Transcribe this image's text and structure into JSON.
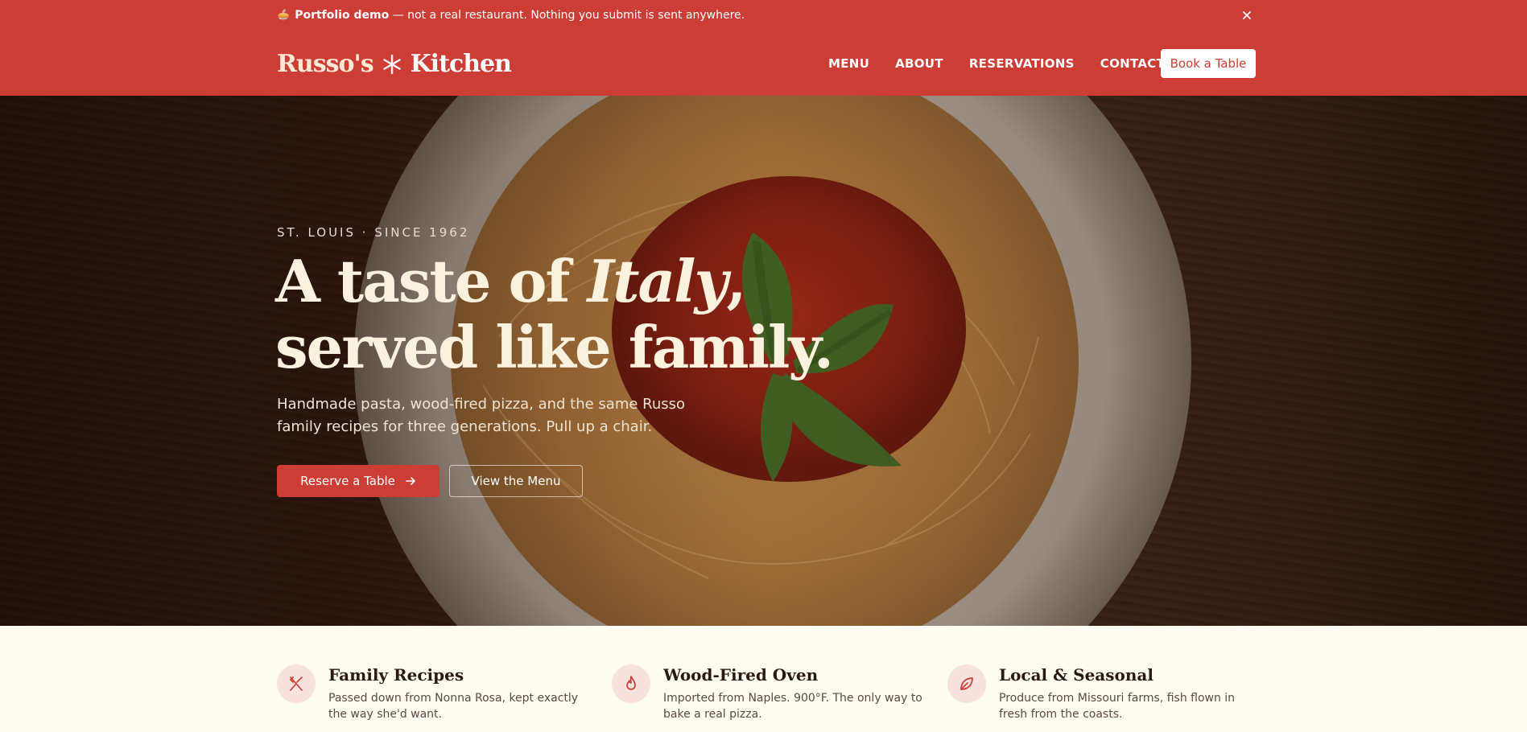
{
  "banner": {
    "icon": "pie-icon",
    "title": "Portfolio demo",
    "text": " — not a real restaurant. Nothing you submit is sent anywhere."
  },
  "brand": {
    "part1": "Russo's",
    "part2": "Kitchen"
  },
  "nav": {
    "items": [
      "MENU",
      "ABOUT",
      "RESERVATIONS",
      "CONTACT"
    ],
    "cta": "Book a Table"
  },
  "hero": {
    "eyebrow": "ST. LOUIS · SINCE 1962",
    "headline_a": "A taste of ",
    "headline_em": "Italy",
    "headline_b": ",",
    "headline_line2": "served like family.",
    "lede": "Handmade pasta, wood-fired pizza, and the same Russo family recipes for three generations. Pull up a chair.",
    "primary": "Reserve a Table",
    "secondary": "View the Menu"
  },
  "features": [
    {
      "icon": "utensils-icon",
      "title": "Family Recipes",
      "text": "Passed down from Nonna Rosa, kept exactly the way she'd want."
    },
    {
      "icon": "flame-icon",
      "title": "Wood-Fired Oven",
      "text": "Imported from Naples. 900°F. The only way to bake a real pizza."
    },
    {
      "icon": "leaf-icon",
      "title": "Local & Seasonal",
      "text": "Produce from Missouri farms, fish flown in fresh from the coasts."
    }
  ],
  "colors": {
    "brand": "#cb3d35",
    "cream": "#fffcf3",
    "ink": "#2b1a12"
  }
}
